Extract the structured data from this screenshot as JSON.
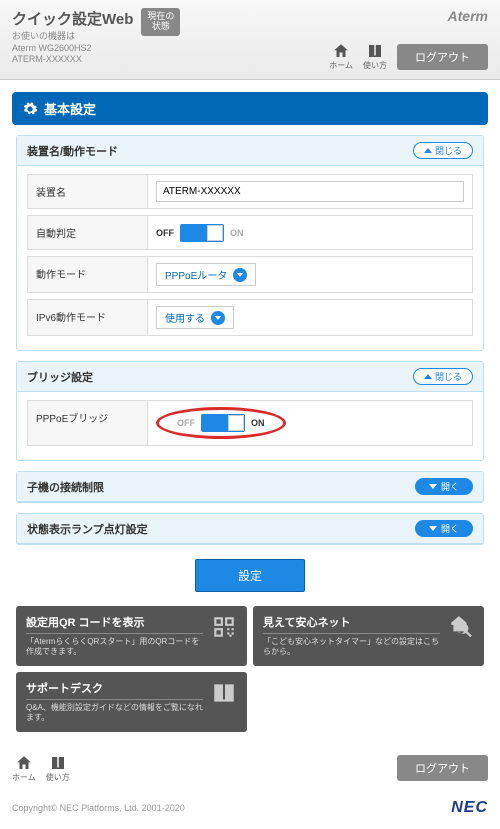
{
  "header": {
    "title": "クイック設定Web",
    "subtitle_line1": "お使いの機器は",
    "subtitle_line2": "Aterm WG2600HS2",
    "subtitle_line3": "ATERM-XXXXXX",
    "status_btn_l1": "現在の",
    "status_btn_l2": "状態",
    "brand": "Aterm",
    "nav_home": "ホーム",
    "nav_help": "使い方",
    "logout": "ログアウト"
  },
  "section_title": "基本設定",
  "cards": {
    "device": {
      "title": "装置名/動作モード",
      "collapse": "閉じる",
      "rows": {
        "device_name_label": "装置名",
        "device_name_value": "ATERM-XXXXXX",
        "auto_detect_label": "自動判定",
        "auto_off": "OFF",
        "auto_on": "ON",
        "mode_label": "動作モード",
        "mode_value": "PPPoEルータ",
        "ipv6_label": "IPv6動作モード",
        "ipv6_value": "使用する"
      }
    },
    "bridge": {
      "title": "ブリッジ設定",
      "collapse": "閉じる",
      "row_label": "PPPoEブリッジ",
      "off": "OFF",
      "on": "ON"
    },
    "child": {
      "title": "子機の接続制限",
      "expand": "開く"
    },
    "lamp": {
      "title": "状態表示ランプ点灯設定",
      "expand": "開く"
    }
  },
  "apply_btn": "設定",
  "info": {
    "qr_title": "設定用QR コードを表示",
    "qr_desc": "「AtermらくらくQRスタート」用のQRコードを作成できます。",
    "safety_title": "見えて安心ネット",
    "safety_desc": "「こども安心ネットタイマー」などの設定はこちらから。",
    "support_title": "サポートデスク",
    "support_desc": "Q&A、機能別設定ガイドなどの情報をご覧になれます。"
  },
  "footer": {
    "home": "ホーム",
    "help": "使い方",
    "logout": "ログアウト",
    "copyright": "Copyright© NEC Platforms, Ltd. 2001-2020",
    "nec": "NEC"
  }
}
